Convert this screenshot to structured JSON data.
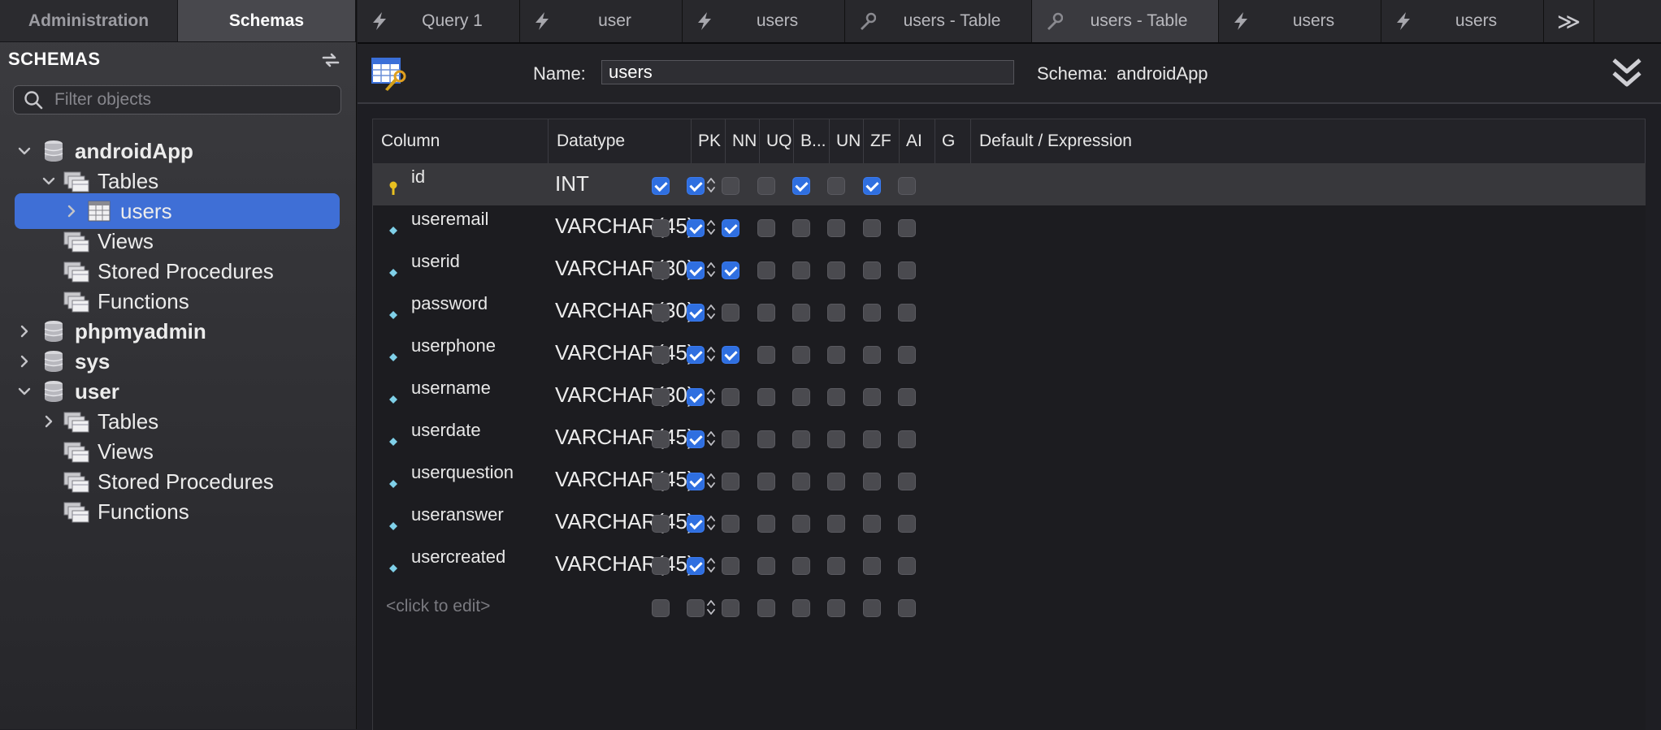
{
  "sidebar": {
    "tabs": [
      "Administration",
      "Schemas"
    ],
    "active_tab": "Schemas",
    "header": "SCHEMAS",
    "filter_placeholder": "Filter objects",
    "tree": [
      {
        "label": "androidApp",
        "kind": "schema",
        "expanded": true
      },
      {
        "label": "Tables",
        "kind": "folder",
        "expanded": true
      },
      {
        "label": "users",
        "kind": "table",
        "selected": true
      },
      {
        "label": "Views",
        "kind": "folder"
      },
      {
        "label": "Stored Procedures",
        "kind": "folder"
      },
      {
        "label": "Functions",
        "kind": "folder"
      },
      {
        "label": "phpmyadmin",
        "kind": "schema",
        "expanded": false
      },
      {
        "label": "sys",
        "kind": "schema",
        "expanded": false
      },
      {
        "label": "user",
        "kind": "schema",
        "expanded": true
      },
      {
        "label": "Tables",
        "kind": "folder",
        "expanded": false
      },
      {
        "label": "Views",
        "kind": "folder"
      },
      {
        "label": "Stored Procedures",
        "kind": "folder"
      },
      {
        "label": "Functions",
        "kind": "folder"
      }
    ]
  },
  "tabs": [
    {
      "label": "Query 1",
      "icon": "lightning-icon"
    },
    {
      "label": "user",
      "icon": "lightning-icon"
    },
    {
      "label": "users",
      "icon": "lightning-icon"
    },
    {
      "label": "users - Table",
      "icon": "wrench-icon"
    },
    {
      "label": "users - Table",
      "icon": "wrench-icon",
      "active": true
    },
    {
      "label": "users",
      "icon": "lightning-icon"
    },
    {
      "label": "users",
      "icon": "lightning-icon"
    }
  ],
  "tab_overflow": "≫",
  "editor": {
    "name_label": "Name:",
    "name_value": "users",
    "schema_label": "Schema:",
    "schema_value": "androidApp"
  },
  "grid": {
    "headers": [
      "Column",
      "Datatype",
      "PK",
      "NN",
      "UQ",
      "B...",
      "UN",
      "ZF",
      "AI",
      "G",
      "Default / Expression"
    ],
    "rows": [
      {
        "name": "id",
        "type": "INT",
        "key": true,
        "flags": [
          1,
          1,
          0,
          0,
          1,
          0,
          1,
          0
        ]
      },
      {
        "name": "useremail",
        "type": "VARCHAR(45)",
        "key": false,
        "flags": [
          0,
          1,
          1,
          0,
          0,
          0,
          0,
          0
        ]
      },
      {
        "name": "userid",
        "type": "VARCHAR(30)",
        "key": false,
        "flags": [
          0,
          1,
          1,
          0,
          0,
          0,
          0,
          0
        ]
      },
      {
        "name": "password",
        "type": "VARCHAR(30)",
        "key": false,
        "flags": [
          0,
          1,
          0,
          0,
          0,
          0,
          0,
          0
        ]
      },
      {
        "name": "userphone",
        "type": "VARCHAR(45)",
        "key": false,
        "flags": [
          0,
          1,
          1,
          0,
          0,
          0,
          0,
          0
        ]
      },
      {
        "name": "username",
        "type": "VARCHAR(30)",
        "key": false,
        "flags": [
          0,
          1,
          0,
          0,
          0,
          0,
          0,
          0
        ]
      },
      {
        "name": "userdate",
        "type": "VARCHAR(45)",
        "key": false,
        "flags": [
          0,
          1,
          0,
          0,
          0,
          0,
          0,
          0
        ]
      },
      {
        "name": "userquestion",
        "type": "VARCHAR(45)",
        "key": false,
        "flags": [
          0,
          1,
          0,
          0,
          0,
          0,
          0,
          0
        ]
      },
      {
        "name": "useranswer",
        "type": "VARCHAR(45)",
        "key": false,
        "flags": [
          0,
          1,
          0,
          0,
          0,
          0,
          0,
          0
        ]
      },
      {
        "name": "usercreated",
        "type": "VARCHAR(45)",
        "key": false,
        "flags": [
          0,
          1,
          0,
          0,
          0,
          0,
          0,
          0
        ]
      }
    ],
    "new_row_placeholder": "<click to edit>"
  },
  "colors": {
    "accent": "#3f6fd6",
    "checkbox_on": "#2f6fe0",
    "selected_row": "#38383c"
  }
}
